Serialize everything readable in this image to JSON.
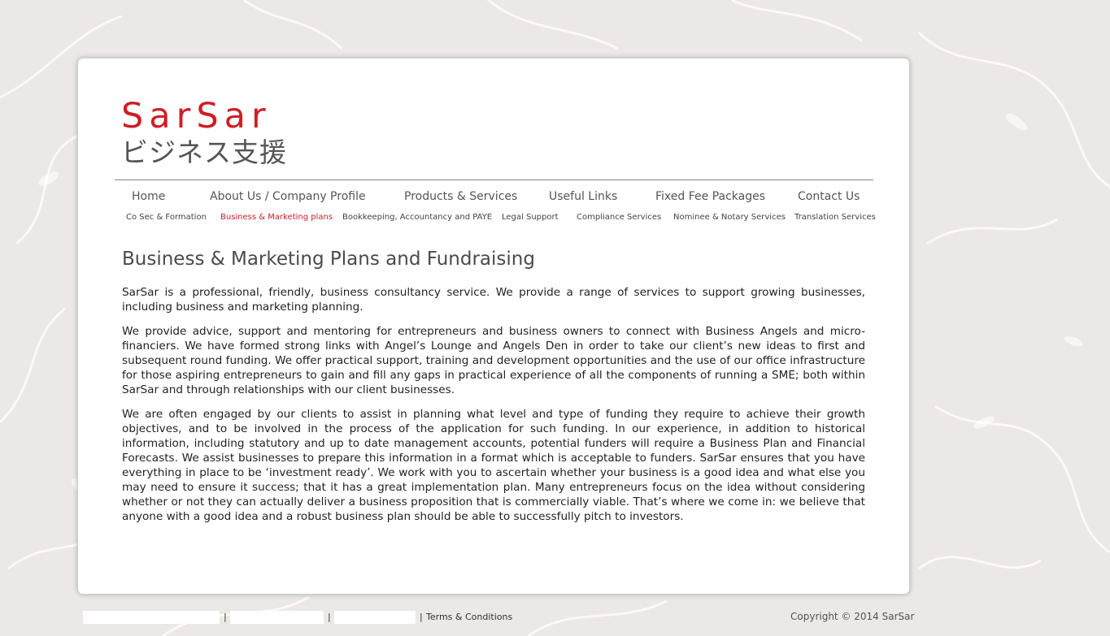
{
  "logo": {
    "brand": "SarSar",
    "subtitle": "ビジネス支援"
  },
  "nav": {
    "main": [
      "Home",
      "About Us / Company Profile",
      "Products & Services",
      "Useful Links",
      "Fixed Fee Packages",
      "Contact Us"
    ],
    "sub": [
      "Co Sec & Formation",
      "Business & Marketing plans",
      "Bookkeeping, Accountancy and PAYE",
      "Legal Support",
      "Compliance Services",
      "Nominee & Notary Services",
      "Translation Services"
    ],
    "active_sub": "Business & Marketing plans"
  },
  "page": {
    "title": "Business & Marketing Plans and Fundraising",
    "paragraphs": [
      "SarSar is a professional, friendly, business consultancy service. We provide a range of services to support growing businesses, including business and marketing planning.",
      "We provide advice, support and mentoring for entrepreneurs and business owners to connect with Business Angels and micro-financiers. We have formed strong links with Angel’s Lounge and Angels Den in order to take our client’s new ideas to first and subsequent round funding. We offer practical support, training and development opportunities and the use of our office infrastructure for those aspiring entrepreneurs to gain and fill any gaps in practical experience of all the components of running a SME; both within SarSar and through relationships with our client businesses.",
      "We are often engaged by our clients to assist in planning what level and type of funding they require to achieve their growth objectives, and to be involved in the process of the application for such funding.  In our experience, in addition to historical information, including statutory and up to date management accounts, potential funders will require a Business Plan and Financial Forecasts. We assist businesses to prepare this information in a format which is acceptable to funders. SarSar ensures that you have everything in place to be ‘investment ready’. We work with you to ascertain whether your business is a good idea and what else you may need to ensure it success; that it has a great implementation plan.  Many entrepreneurs focus on the idea without considering whether or not they can actually deliver a business proposition that is commercially viable.  That’s where we come in: we believe that anyone with a good idea and a robust business plan should be able to successfully pitch to investors."
    ]
  },
  "footer": {
    "separator": "|",
    "terms": "Terms & Conditions",
    "copyright": "Copyright © 2014 SarSar"
  },
  "colors": {
    "brand_red": "#cc1f26",
    "background": "#ebe8e7"
  }
}
